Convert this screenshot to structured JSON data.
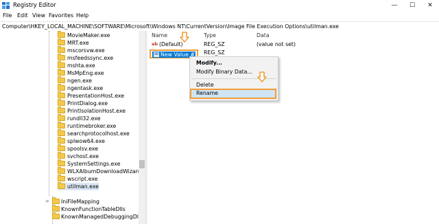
{
  "window": {
    "title": "Registry Editor",
    "controls": {
      "minimize": "—",
      "maximize": "☐",
      "close": "✕"
    }
  },
  "menu": [
    "File",
    "Edit",
    "View",
    "Favorites",
    "Help"
  ],
  "address": "Computer\\HKEY_LOCAL_MACHINE\\SOFTWARE\\Microsoft\\Windows NT\\CurrentVersion\\Image File Execution Options\\utilman.exe",
  "tree": {
    "items": [
      "MovieMaker.exe",
      "MRT.exe",
      "mscorsvw.exe",
      "msfeedssync.exe",
      "mshta.exe",
      "MsMpEng.exe",
      "ngen.exe",
      "ngentask.exe",
      "PresentationHost.exe",
      "PrintDialog.exe",
      "PrintIsolationHost.exe",
      "rundll32.exe",
      "runtimebroker.exe",
      "searchprotocolhost.exe",
      "splwow64.exe",
      "spoolsv.exe",
      "svchost.exe",
      "SystemSettings.exe",
      "WLXAlbumDownloadWizard.exe",
      "wscript.exe",
      "utilman.exe"
    ],
    "selected": "utilman.exe",
    "lower_items": [
      "IniFileMapping",
      "KnownFunctionTableDlls",
      "KnownManagedDebuggingDlls"
    ]
  },
  "list": {
    "headers": {
      "name": "Name",
      "type": "Type",
      "data": "Data"
    },
    "rows": [
      {
        "name": "(Default)",
        "type": "REG_SZ",
        "data": "(value not set)"
      },
      {
        "name": "New Value #1",
        "type": "REG_SZ",
        "data": ""
      }
    ]
  },
  "context_menu": {
    "items": [
      "Modify...",
      "Modify Binary Data...",
      "Delete",
      "Rename"
    ],
    "highlighted": "Rename"
  },
  "colors": {
    "accent": "#0078d7",
    "highlight_border": "#f39c34",
    "folder": "#f2c94c"
  }
}
